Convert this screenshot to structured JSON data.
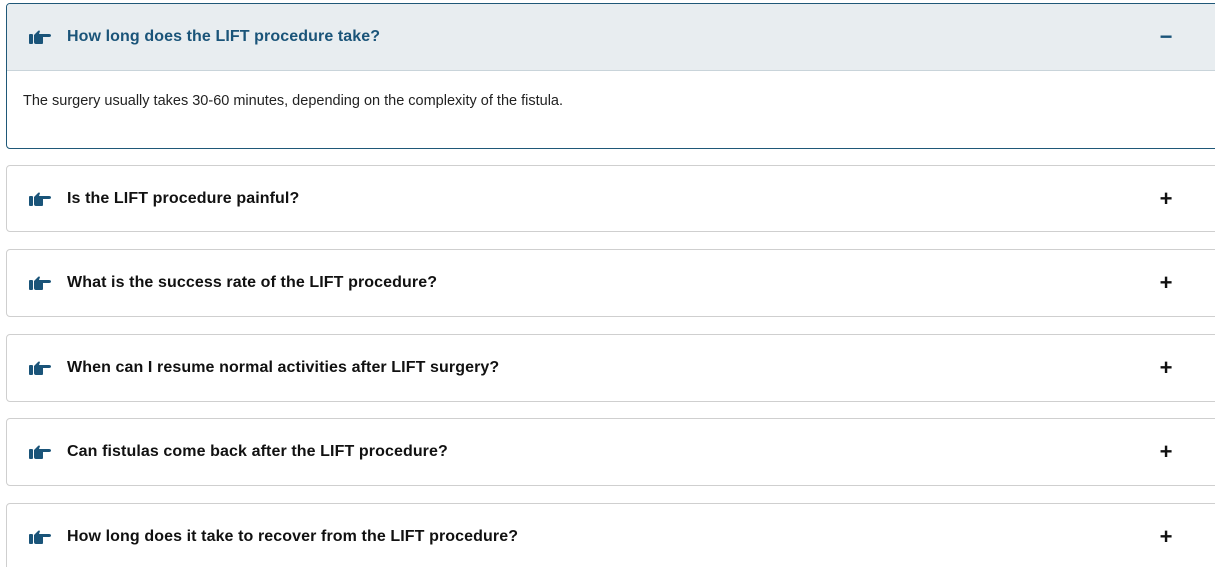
{
  "accent_color": "#1a5479",
  "faq": {
    "items": [
      {
        "question": "How long does the LIFT procedure take?",
        "answer": "The surgery usually takes 30-60 minutes, depending on the complexity of the fistula.",
        "expanded": true,
        "toggle": "−",
        "icon": "hand-pointing-right-icon"
      },
      {
        "question": "Is the LIFT procedure painful?",
        "expanded": false,
        "toggle": "+",
        "icon": "hand-pointing-right-icon"
      },
      {
        "question": "What is the success rate of the LIFT procedure?",
        "expanded": false,
        "toggle": "+",
        "icon": "hand-pointing-right-icon"
      },
      {
        "question": "When can I resume normal activities after LIFT surgery?",
        "expanded": false,
        "toggle": "+",
        "icon": "hand-pointing-right-icon"
      },
      {
        "question": "Can fistulas come back after the LIFT procedure?",
        "expanded": false,
        "toggle": "+",
        "icon": "hand-pointing-right-icon"
      },
      {
        "question": "How long does it take to recover from the LIFT procedure?",
        "expanded": false,
        "toggle": "+",
        "icon": "hand-pointing-right-icon"
      }
    ]
  }
}
